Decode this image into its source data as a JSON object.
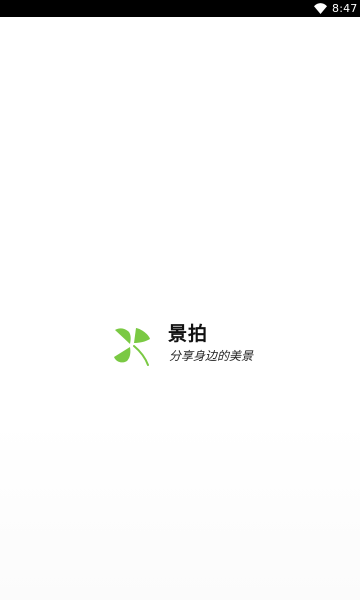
{
  "status_bar": {
    "time": "8:47",
    "wifi_icon": "wifi-icon",
    "background": "#000000",
    "text_color": "#ffffff"
  },
  "splash": {
    "app_name": "景拍",
    "slogan": "分享身边的美景",
    "logo_icon": "clover-logo-icon",
    "logo_color": "#7ac943"
  }
}
